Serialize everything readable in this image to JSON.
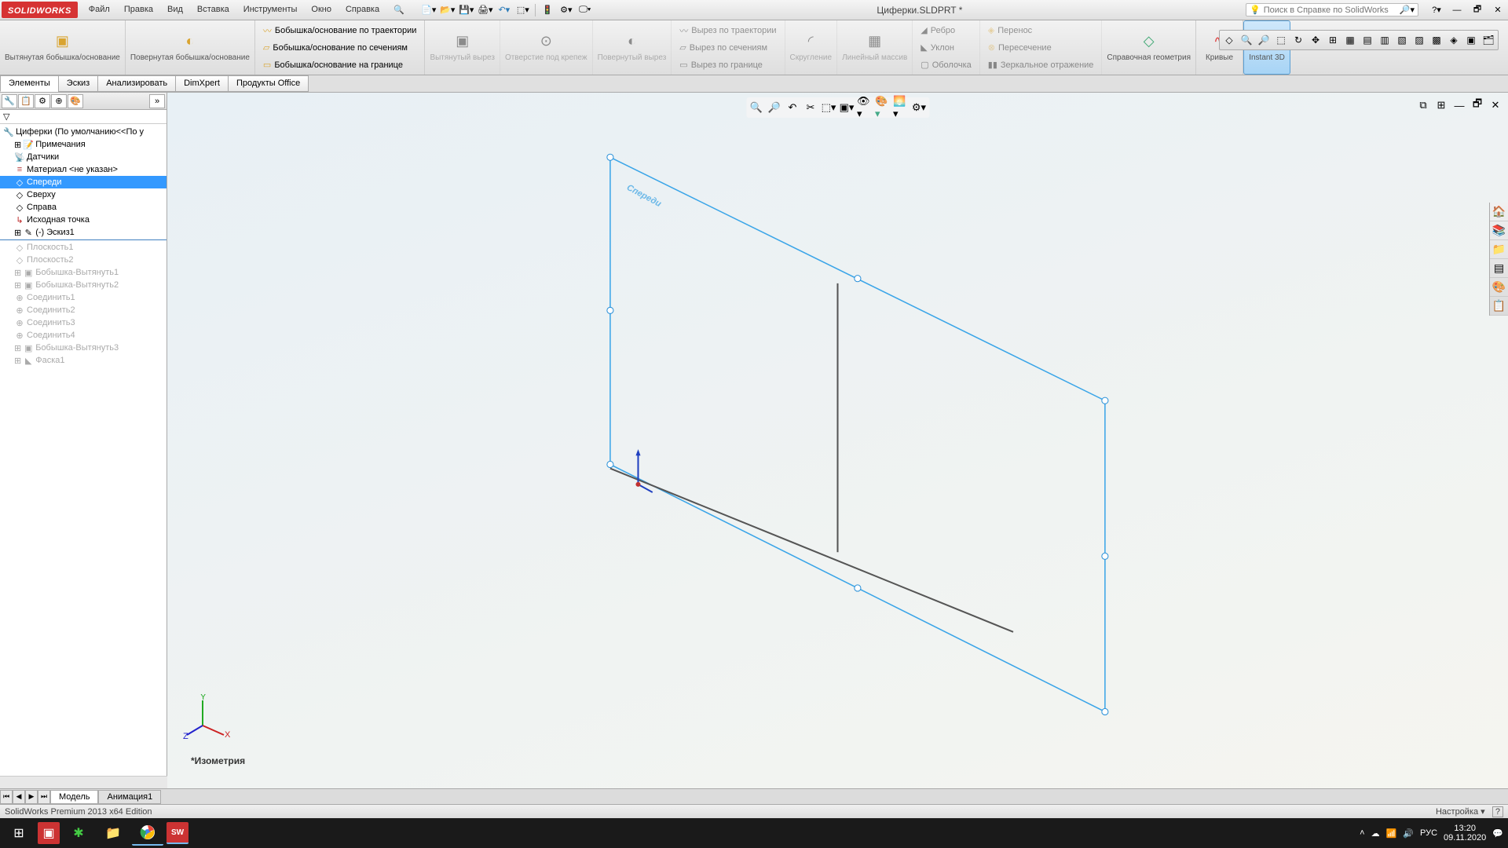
{
  "app": {
    "logo": "SOLIDWORKS"
  },
  "menu": {
    "file": "Файл",
    "edit": "Правка",
    "view": "Вид",
    "insert": "Вставка",
    "tools": "Инструменты",
    "window": "Окно",
    "help": "Справка"
  },
  "title": "Циферки.SLDPRT *",
  "search": {
    "placeholder": "Поиск в Справке по SolidWorks"
  },
  "ribbon": {
    "extruded_boss": "Вытянутая бобышка/основание",
    "revolved_boss": "Повернутая бобышка/основание",
    "swept_boss": "Бобышка/основание по траектории",
    "lofted_boss": "Бобышка/основание по сечениям",
    "boundary_boss": "Бобышка/основание на границе",
    "extruded_cut": "Вытянутый вырез",
    "hole": "Отверстие под крепеж",
    "revolved_cut": "Повернутый вырез",
    "swept_cut": "Вырез по траектории",
    "lofted_cut": "Вырез по сечениям",
    "boundary_cut": "Вырез по границе",
    "fillet": "Скругление",
    "linear_pattern": "Линейный массив",
    "rib": "Ребро",
    "draft": "Уклон",
    "shell": "Оболочка",
    "wrap": "Перенос",
    "intersect": "Пересечение",
    "mirror": "Зеркальное отражение",
    "ref_geom": "Справочная геометрия",
    "curves": "Кривые",
    "instant3d": "Instant 3D"
  },
  "tabs": {
    "features": "Элементы",
    "sketch": "Эскиз",
    "evaluate": "Анализировать",
    "dimxpert": "DimXpert",
    "office": "Продукты Office"
  },
  "tree": {
    "root": "Циферки  (По умолчанию<<По у",
    "annotations": "Примечания",
    "sensors": "Датчики",
    "material": "Материал <не указан>",
    "front": "Спереди",
    "top": "Сверху",
    "right": "Справа",
    "origin": "Исходная точка",
    "sketch1": "(-) Эскиз1",
    "plane1": "Плоскость1",
    "plane2": "Плоскость2",
    "boss1": "Бобышка-Вытянуть1",
    "boss2": "Бобышка-Вытянуть2",
    "comb1": "Соединить1",
    "comb2": "Соединить2",
    "comb3": "Соединить3",
    "comb4": "Соединить4",
    "boss3": "Бобышка-Вытянуть3",
    "chamfer1": "Фаска1"
  },
  "viewport": {
    "plane_label": "Спереди",
    "view_name": "*Изометрия"
  },
  "bottom_tabs": {
    "model": "Модель",
    "anim": "Анимация1"
  },
  "status": {
    "left": "SolidWorks Premium 2013 x64 Edition",
    "custom": "Настройка",
    "help": "?"
  },
  "taskbar": {
    "lang": "РУС",
    "time": "13:20",
    "date": "09.11.2020"
  }
}
